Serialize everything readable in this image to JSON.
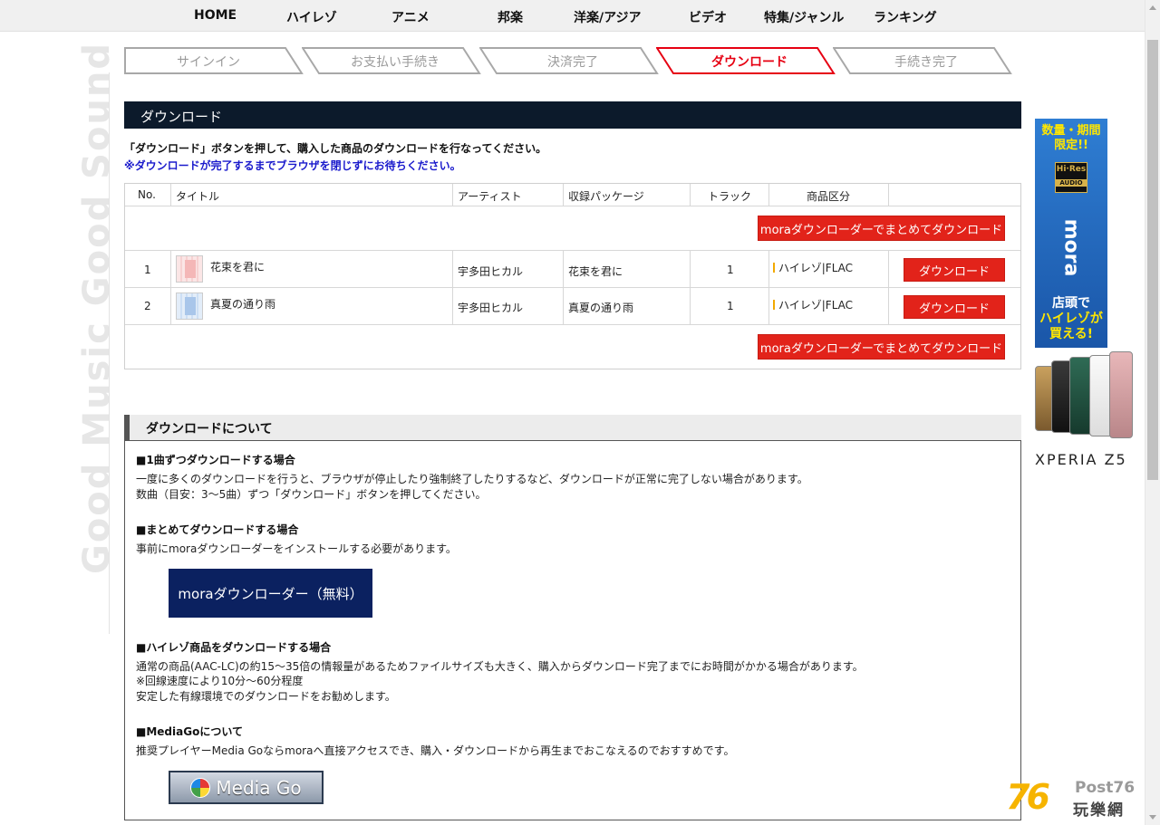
{
  "nav": [
    "HOME",
    "ハイレゾ",
    "アニメ",
    "邦楽",
    "洋楽/アジア",
    "ビデオ",
    "特集/ジャンル",
    "ランキング"
  ],
  "brand_vertical": "Good Music Good Sound",
  "steps": [
    {
      "label": "サインイン",
      "active": false
    },
    {
      "label": "お支払い手続き",
      "active": false
    },
    {
      "label": "決済完了",
      "active": false
    },
    {
      "label": "ダウンロード",
      "active": true
    },
    {
      "label": "手続き完了",
      "active": false
    }
  ],
  "download_section": {
    "title": "ダウンロード",
    "notice": "「ダウンロード」ボタンを押して、購入した商品のダウンロードを行なってください。",
    "warning": "※ダウンロードが完了するまでブラウザを閉じずにお待ちください。"
  },
  "table": {
    "headers": [
      "No.",
      "タイトル",
      "アーティスト",
      "収録パッケージ",
      "トラック",
      "商品区分"
    ],
    "bulk_download_label": "moraダウンローダーでまとめてダウンロード",
    "rows": [
      {
        "no": "1",
        "title": "花束を君に",
        "artist": "宇多田ヒカル",
        "package": "花束を君に",
        "track": "1",
        "format": "ハイレゾ|FLAC",
        "button": "ダウンロード"
      },
      {
        "no": "2",
        "title": "真夏の通り雨",
        "artist": "宇多田ヒカル",
        "package": "真夏の通り雨",
        "track": "1",
        "format": "ハイレゾ|FLAC",
        "button": "ダウンロード"
      }
    ]
  },
  "about": {
    "title": "ダウンロードについて",
    "sections": [
      {
        "heading": "■1曲ずつダウンロードする場合",
        "lines": [
          "一度に多くのダウンロードを行うと、ブラウザが停止したり強制終了したりするなど、ダウンロードが正常に完了しない場合があります。",
          "数曲（目安：3～5曲）ずつ「ダウンロード」ボタンを押してください。"
        ]
      },
      {
        "heading": "■まとめてダウンロードする場合",
        "lines": [
          "事前にmoraダウンローダーをインストールする必要があります。"
        ]
      },
      {
        "heading": "■ハイレゾ商品をダウンロードする場合",
        "lines": [
          "通常の商品(AAC-LC)の約15～35倍の情報量があるためファイルサイズも大きく、購入からダウンロード完了までにお時間がかかる場合があります。",
          "※回線速度により10分～60分程度",
          "安定した有線環境でのダウンロードをお勧めします。"
        ]
      },
      {
        "heading": "■MediaGoについて",
        "lines": [
          "推奨プレイヤーMedia Goならmoraへ直接アクセスでき、購入・ダウンロードから再生までおこなえるのでおすすめです。"
        ]
      }
    ],
    "downloader_button": "moraダウンローダー（無料）",
    "mediago_button": "Media Go"
  },
  "banners": {
    "hires_top": [
      "数量・期間",
      "限定!!"
    ],
    "hires_badge": [
      "Hi·Res",
      "AUDIO"
    ],
    "hires_vertical": "mora",
    "hires_bottom": [
      "店頭で",
      "ハイレゾが",
      "買える!"
    ],
    "xperia": "XPERIA Z5"
  },
  "watermark": {
    "number": "76",
    "post": "Post76",
    "cn": "玩樂網"
  },
  "colors": {
    "accent_red": "#e2231a",
    "header_dark": "#0c1a2b",
    "navy": "#0b2160",
    "warning_blue": "#1a1acc"
  }
}
